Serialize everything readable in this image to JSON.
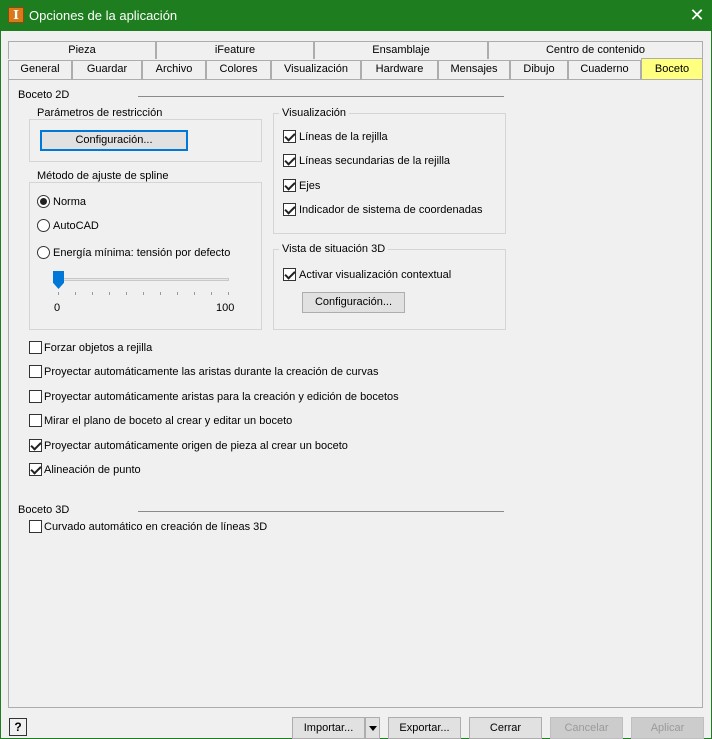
{
  "window": {
    "title": "Opciones de la aplicación"
  },
  "tabs_top": [
    "Pieza",
    "iFeature",
    "Ensamblaje",
    "Centro de contenido"
  ],
  "tabs_bottom": [
    "General",
    "Guardar",
    "Archivo",
    "Colores",
    "Visualización",
    "Hardware",
    "Mensajes",
    "Dibujo",
    "Cuaderno",
    "Boceto"
  ],
  "active_tab": "Boceto",
  "sketch2d": {
    "section": "Boceto 2D",
    "restriction": {
      "title": "Parámetros de restricción",
      "button": "Configuración..."
    },
    "spline": {
      "title": "Método de ajuste de spline",
      "options": [
        "Norma",
        "AutoCAD",
        "Energía mínima: tensión por defecto"
      ],
      "selected": "Norma",
      "slider_min": "0",
      "slider_max": "100",
      "slider_value": 0
    },
    "display": {
      "title": "Visualización",
      "items": [
        {
          "label": "Líneas de la rejilla",
          "checked": true
        },
        {
          "label": "Líneas secundarias de la rejilla",
          "checked": true
        },
        {
          "label": "Ejes",
          "checked": true
        },
        {
          "label": "Indicador de sistema de coordenadas",
          "checked": true
        }
      ]
    },
    "heads_up": {
      "title": "Vista de situación 3D",
      "item": {
        "label": "Activar visualización contextual",
        "checked": true
      },
      "button": "Configuración..."
    },
    "options": [
      {
        "label": "Forzar objetos a rejilla",
        "checked": false
      },
      {
        "label": "Proyectar automáticamente las aristas durante la creación de curvas",
        "checked": false
      },
      {
        "label": "Proyectar automáticamente aristas para la creación y edición de bocetos",
        "checked": false
      },
      {
        "label": "Mirar el plano de boceto al crear y editar un boceto",
        "checked": false
      },
      {
        "label": "Proyectar automáticamente origen de pieza al crear un boceto",
        "checked": true
      },
      {
        "label": "Alineación de punto",
        "checked": true
      }
    ]
  },
  "sketch3d": {
    "section": "Boceto 3D",
    "options": [
      {
        "label": "Curvado automático en creación de líneas 3D",
        "checked": false
      }
    ]
  },
  "footer": {
    "help": "?",
    "import": "Importar...",
    "export": "Exportar...",
    "close": "Cerrar",
    "cancel": "Cancelar",
    "apply": "Aplicar"
  }
}
